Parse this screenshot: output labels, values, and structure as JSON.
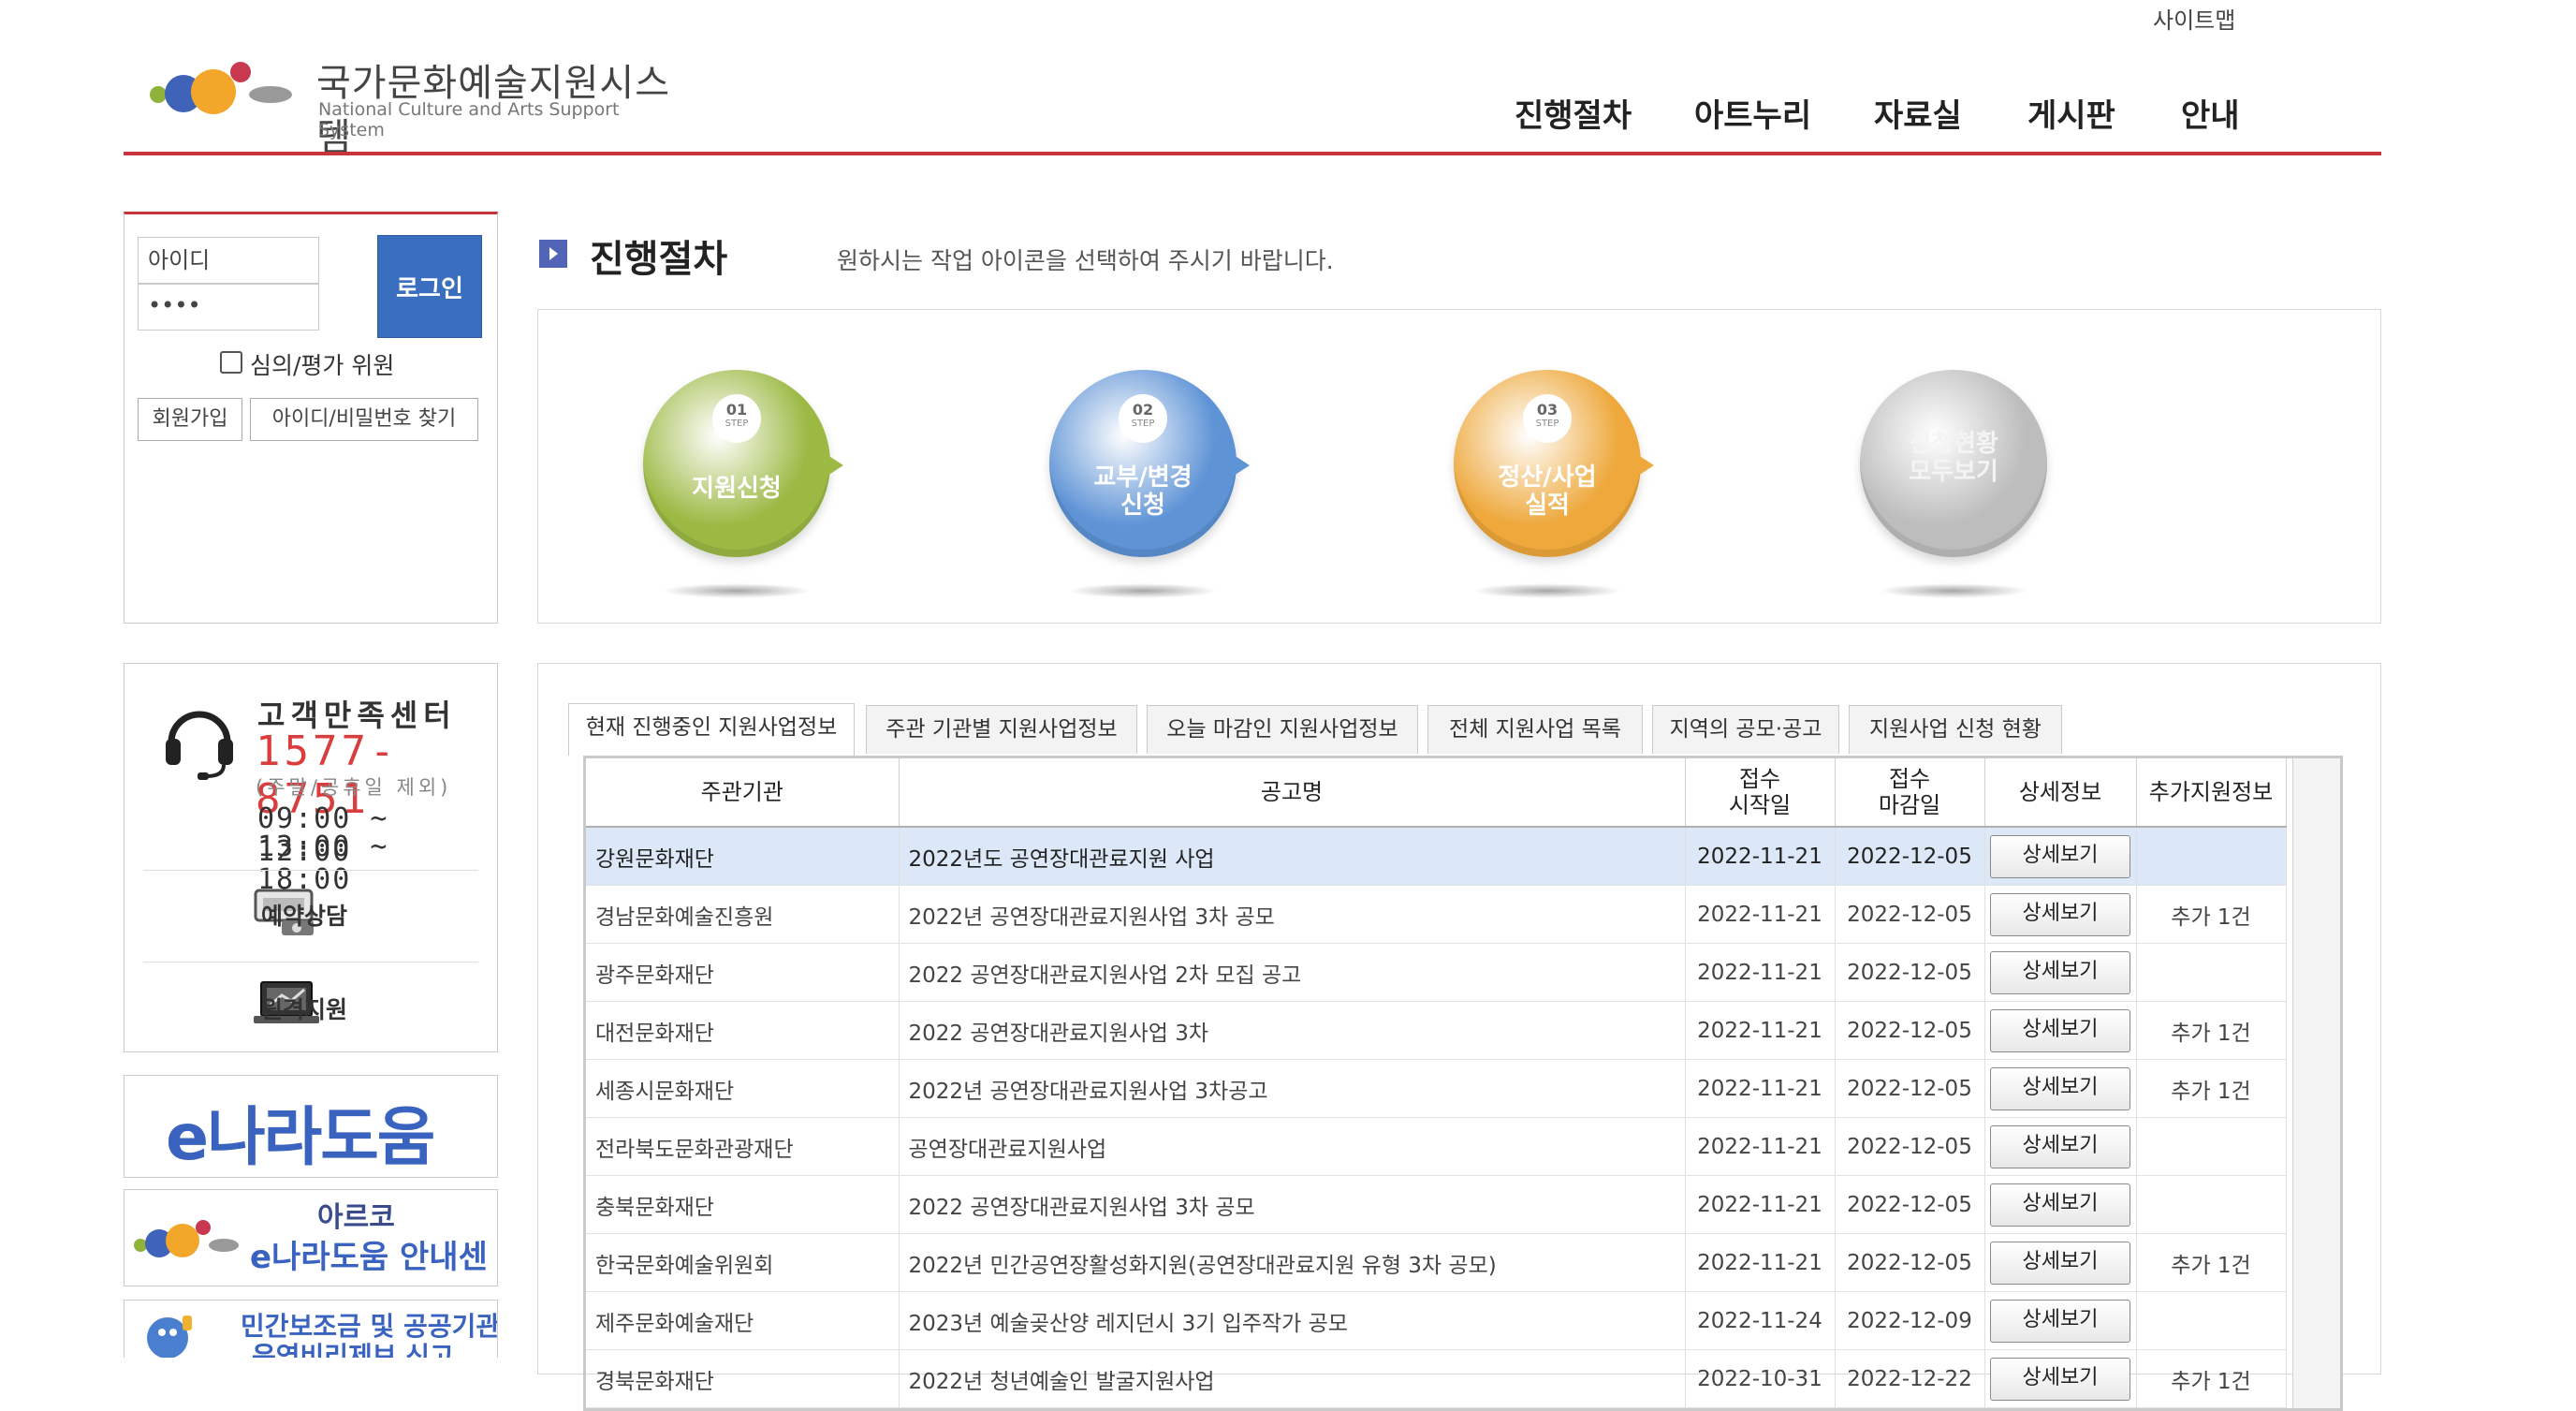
{
  "header": {
    "sitemap_label": "사이트맵",
    "logo_title": "국가문화예술지원시스템",
    "logo_subtitle": "National Culture and Arts Support System",
    "nav": [
      "진행절차",
      "아트누리",
      "자료실",
      "게시판",
      "안내"
    ]
  },
  "login": {
    "id_value": "아이디",
    "pw_value": "••••",
    "login_label": "로그인",
    "judge_label": "심의/평가 위원",
    "join_label": "회원가입",
    "find_label": "아이디/비밀번호 찾기"
  },
  "customer_center": {
    "title": "고객만족센터",
    "phone": "1577-8751",
    "note": "(주말/공휴일 제외)",
    "hours": [
      "09:00 ~ 12:00",
      "13:00 ~ 18:00"
    ],
    "links": [
      "예약상담",
      "원격지원"
    ],
    "icons": [
      "headset-icon",
      "phone-device-icon",
      "laptop-icon"
    ]
  },
  "banners": {
    "enara": "e나라도움",
    "arko_top": "아르코",
    "arko_bottom": "e나라도움 안내센터",
    "report_line1": "민간보조금 및 공공기관",
    "report_line2": "운영비리제보 신고"
  },
  "main": {
    "section_title": "진행절차",
    "section_desc": "원하시는 작업 아이콘을 선택하여 주시기 바랍니다.",
    "steps": [
      {
        "num": "01",
        "step": "STEP",
        "label1": "지원신청",
        "label2": "",
        "color": "#9cb944"
      },
      {
        "num": "02",
        "step": "STEP",
        "label1": "교부/변경",
        "label2": "신청",
        "color": "#5e93d6"
      },
      {
        "num": "03",
        "step": "STEP",
        "label1": "정산/사업",
        "label2": "실적",
        "color": "#eea83b"
      },
      {
        "num": "",
        "step": "",
        "label1": "신청현황",
        "label2": "모두보기",
        "color": "#bdbdbd"
      }
    ]
  },
  "tabs": [
    "현재 진행중인 지원사업정보",
    "주관 기관별 지원사업정보",
    "오늘 마감인 지원사업정보",
    "전체 지원사업 목록",
    "지역의 공모·공고",
    "지원사업 신청 현황"
  ],
  "table": {
    "headers": [
      "주관기관",
      "공고명",
      "접수\n시작일",
      "접수\n마감일",
      "상세정보",
      "추가지원정보"
    ],
    "rows": [
      {
        "org": "강원문화재단",
        "title": "2022년도 공연장대관료지원 사업",
        "start": "2022-11-21",
        "end": "2022-12-05",
        "btn": "상세보기",
        "extra": ""
      },
      {
        "org": "경남문화예술진흥원",
        "title": "2022년 공연장대관료지원사업 3차 공모",
        "start": "2022-11-21",
        "end": "2022-12-05",
        "btn": "상세보기",
        "extra": "추가 1건"
      },
      {
        "org": "광주문화재단",
        "title": "2022 공연장대관료지원사업 2차 모집 공고",
        "start": "2022-11-21",
        "end": "2022-12-05",
        "btn": "상세보기",
        "extra": ""
      },
      {
        "org": "대전문화재단",
        "title": "2022 공연장대관료지원사업 3차",
        "start": "2022-11-21",
        "end": "2022-12-05",
        "btn": "상세보기",
        "extra": "추가 1건"
      },
      {
        "org": "세종시문화재단",
        "title": "2022년 공연장대관료지원사업 3차공고",
        "start": "2022-11-21",
        "end": "2022-12-05",
        "btn": "상세보기",
        "extra": "추가 1건"
      },
      {
        "org": "전라북도문화관광재단",
        "title": "공연장대관료지원사업",
        "start": "2022-11-21",
        "end": "2022-12-05",
        "btn": "상세보기",
        "extra": ""
      },
      {
        "org": "충북문화재단",
        "title": "2022 공연장대관료지원사업 3차 공모",
        "start": "2022-11-21",
        "end": "2022-12-05",
        "btn": "상세보기",
        "extra": ""
      },
      {
        "org": "한국문화예술위원회",
        "title": "2022년 민간공연장활성화지원(공연장대관료지원 유형 3차 공모)",
        "start": "2022-11-21",
        "end": "2022-12-05",
        "btn": "상세보기",
        "extra": "추가 1건"
      },
      {
        "org": "제주문화예술재단",
        "title": "2023년 예술곶산양 레지던시 3기 입주작가 공모",
        "start": "2022-11-24",
        "end": "2022-12-09",
        "btn": "상세보기",
        "extra": ""
      },
      {
        "org": "경북문화재단",
        "title": "2022년 청년예술인 발굴지원사업",
        "start": "2022-10-31",
        "end": "2022-12-22",
        "btn": "상세보기",
        "extra": "추가 1건"
      }
    ]
  },
  "colors": {
    "accent_red": "#c7343c",
    "login_blue": "#3a6fc0",
    "selected_row": "#dce8f7"
  }
}
